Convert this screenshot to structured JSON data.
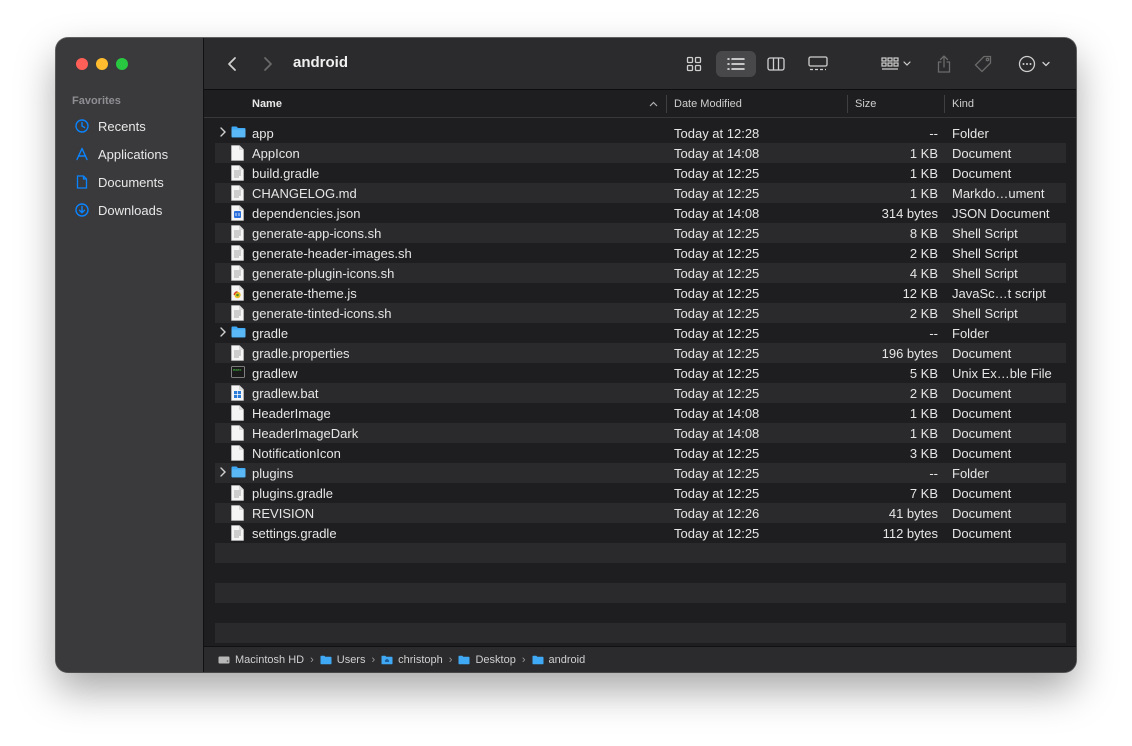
{
  "window": {
    "title": "android"
  },
  "sidebar": {
    "section_title": "Favorites",
    "items": [
      {
        "label": "Recents",
        "icon": "clock-icon"
      },
      {
        "label": "Applications",
        "icon": "applications-icon"
      },
      {
        "label": "Documents",
        "icon": "document-icon"
      },
      {
        "label": "Downloads",
        "icon": "download-icon"
      }
    ]
  },
  "columns": {
    "name": "Name",
    "date": "Date Modified",
    "size": "Size",
    "kind": "Kind"
  },
  "files": [
    {
      "name": "app",
      "date": "Today at 12:28",
      "size": "--",
      "kind": "Folder",
      "type": "folder"
    },
    {
      "name": "AppIcon",
      "date": "Today at 14:08",
      "size": "1 KB",
      "kind": "Document",
      "type": "blank"
    },
    {
      "name": "build.gradle",
      "date": "Today at 12:25",
      "size": "1 KB",
      "kind": "Document",
      "type": "text"
    },
    {
      "name": "CHANGELOG.md",
      "date": "Today at 12:25",
      "size": "1 KB",
      "kind": "Markdo…ument",
      "type": "text"
    },
    {
      "name": "dependencies.json",
      "date": "Today at 14:08",
      "size": "314 bytes",
      "kind": "JSON Document",
      "type": "json"
    },
    {
      "name": "generate-app-icons.sh",
      "date": "Today at 12:25",
      "size": "8 KB",
      "kind": "Shell Script",
      "type": "text"
    },
    {
      "name": "generate-header-images.sh",
      "date": "Today at 12:25",
      "size": "2 KB",
      "kind": "Shell Script",
      "type": "text"
    },
    {
      "name": "generate-plugin-icons.sh",
      "date": "Today at 12:25",
      "size": "4 KB",
      "kind": "Shell Script",
      "type": "text"
    },
    {
      "name": "generate-theme.js",
      "date": "Today at 12:25",
      "size": "12 KB",
      "kind": "JavaSc…t script",
      "type": "js"
    },
    {
      "name": "generate-tinted-icons.sh",
      "date": "Today at 12:25",
      "size": "2 KB",
      "kind": "Shell Script",
      "type": "text"
    },
    {
      "name": "gradle",
      "date": "Today at 12:25",
      "size": "--",
      "kind": "Folder",
      "type": "folder"
    },
    {
      "name": "gradle.properties",
      "date": "Today at 12:25",
      "size": "196 bytes",
      "kind": "Document",
      "type": "text"
    },
    {
      "name": "gradlew",
      "date": "Today at 12:25",
      "size": "5 KB",
      "kind": "Unix Ex…ble File",
      "type": "exec"
    },
    {
      "name": "gradlew.bat",
      "date": "Today at 12:25",
      "size": "2 KB",
      "kind": "Document",
      "type": "bat"
    },
    {
      "name": "HeaderImage",
      "date": "Today at 14:08",
      "size": "1 KB",
      "kind": "Document",
      "type": "blank"
    },
    {
      "name": "HeaderImageDark",
      "date": "Today at 14:08",
      "size": "1 KB",
      "kind": "Document",
      "type": "blank"
    },
    {
      "name": "NotificationIcon",
      "date": "Today at 12:25",
      "size": "3 KB",
      "kind": "Document",
      "type": "blank"
    },
    {
      "name": "plugins",
      "date": "Today at 12:25",
      "size": "--",
      "kind": "Folder",
      "type": "folder"
    },
    {
      "name": "plugins.gradle",
      "date": "Today at 12:25",
      "size": "7 KB",
      "kind": "Document",
      "type": "text"
    },
    {
      "name": "REVISION",
      "date": "Today at 12:26",
      "size": "41 bytes",
      "kind": "Document",
      "type": "blank"
    },
    {
      "name": "settings.gradle",
      "date": "Today at 12:25",
      "size": "112 bytes",
      "kind": "Document",
      "type": "text"
    }
  ],
  "pathbar": [
    {
      "label": "Macintosh HD",
      "icon": "hard-drive-icon"
    },
    {
      "label": "Users",
      "icon": "folder-icon"
    },
    {
      "label": "christoph",
      "icon": "home-folder-icon"
    },
    {
      "label": "Desktop",
      "icon": "folder-icon"
    },
    {
      "label": "android",
      "icon": "folder-icon"
    }
  ],
  "colors": {
    "accent": "#0a84ff",
    "folder": "#3fa9f5"
  }
}
